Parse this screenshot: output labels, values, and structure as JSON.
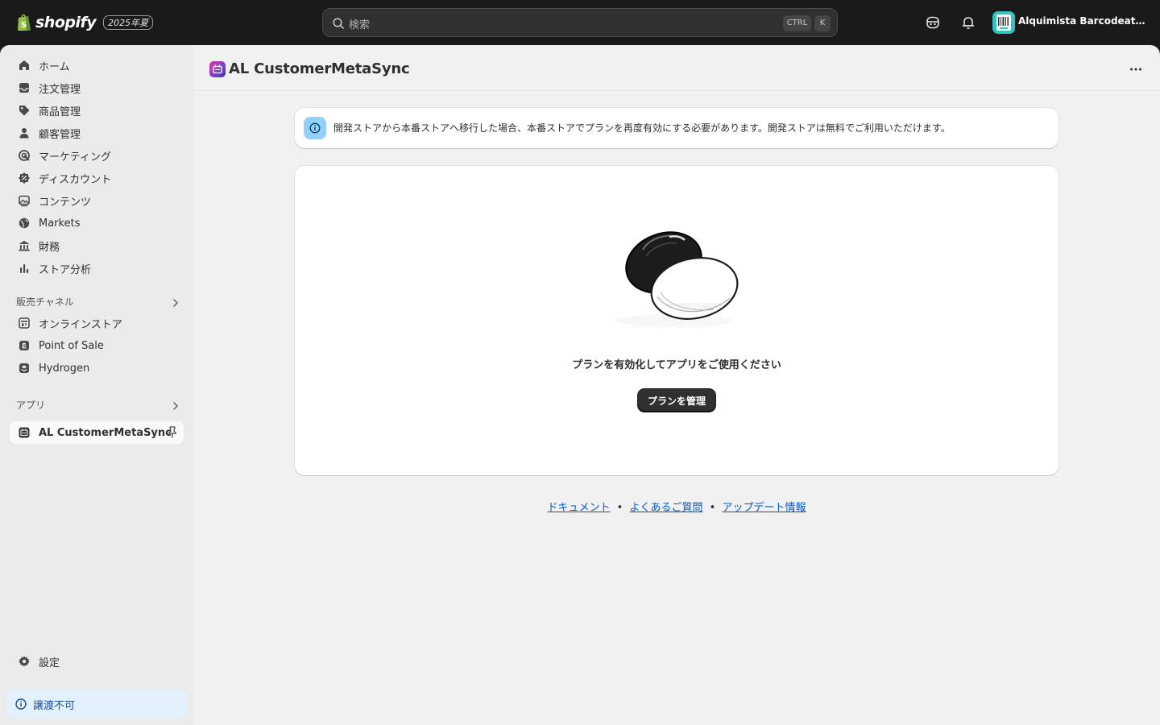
{
  "topbar": {
    "brand": "shopify",
    "edition": "2025年夏",
    "search_placeholder": "検索",
    "kbd_ctrl": "CTRL",
    "kbd_k": "K",
    "store_name": "Alquimista Barcodeator s..."
  },
  "sidebar": {
    "items": [
      {
        "label": "ホーム",
        "icon": "home-icon"
      },
      {
        "label": "注文管理",
        "icon": "inbox-icon"
      },
      {
        "label": "商品管理",
        "icon": "tag-icon"
      },
      {
        "label": "顧客管理",
        "icon": "person-icon"
      },
      {
        "label": "マーケティング",
        "icon": "target-icon"
      },
      {
        "label": "ディスカウント",
        "icon": "discount-icon"
      },
      {
        "label": "コンテンツ",
        "icon": "image-icon"
      },
      {
        "label": "Markets",
        "icon": "globe-icon"
      },
      {
        "label": "財務",
        "icon": "bank-icon"
      },
      {
        "label": "ストア分析",
        "icon": "bar-chart-icon"
      }
    ],
    "sales_channels_header": "販売チャネル",
    "channels": [
      {
        "label": "オンラインストア",
        "icon": "store-icon"
      },
      {
        "label": "Point of Sale",
        "icon": "pos-icon"
      },
      {
        "label": "Hydrogen",
        "icon": "hydrogen-icon"
      }
    ],
    "apps_header": "アプリ",
    "apps": [
      {
        "label": "AL CustomerMetaSync",
        "icon": "app-icon"
      }
    ],
    "settings": "設定",
    "non_transferable": "譲渡不可"
  },
  "page": {
    "title": "AL CustomerMetaSync",
    "banner_text": "開発ストアから本番ストアへ移行した場合、本番ストアでプランを再度有効にする必要があります。開発ストアは無料でご利用いただけます。",
    "empty_title": "プランを有効化してアプリをご使用ください",
    "manage_button": "プランを管理",
    "footer": {
      "docs": "ドキュメント",
      "faq": "よくあるご質問",
      "updates": "アップデート情報",
      "separator": "•"
    }
  }
}
